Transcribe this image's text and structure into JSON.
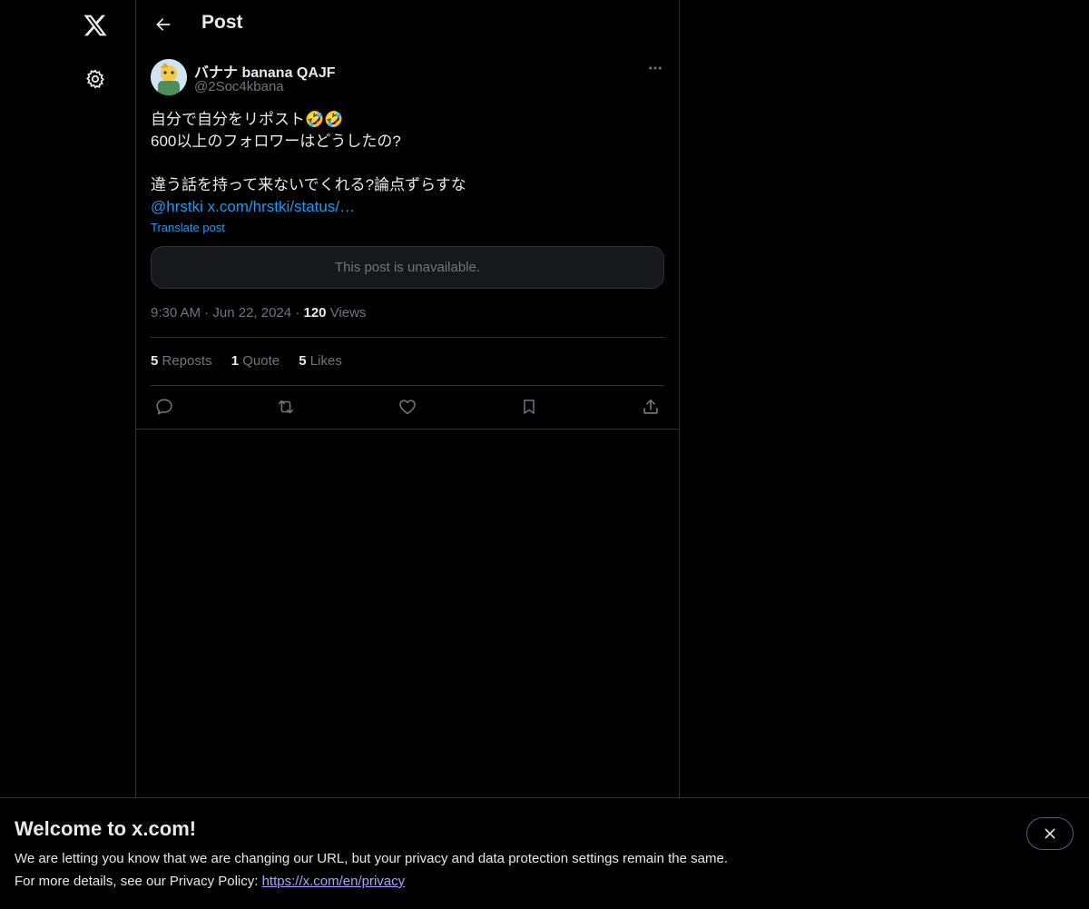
{
  "header": {
    "title": "Post",
    "back_icon": "arrow-left-icon"
  },
  "nav": {
    "logo_icon": "x-logo-icon",
    "settings_icon": "gear-icon"
  },
  "tweet": {
    "author_name": "バナナ banana QAJF",
    "author_handle": "@2Soc4kbana",
    "text_lines": [
      "自分で自分をリポスト🤣🤣",
      "600以上のフォロワーはどうしたの?",
      "",
      "違う話を持って来ないでくれる?論点ずらすな"
    ],
    "link_text": "@hrstki x.com/hrstki/status/…",
    "translate_label": "Translate post",
    "quoted_unavailable": "This post is unavailable.",
    "time": "9:30 AM",
    "date": "Jun 22, 2024",
    "views_count": "120",
    "views_label": "Views",
    "reposts_count": "5",
    "reposts_label": "Reposts",
    "quotes_count": "1",
    "quotes_label": "Quote",
    "likes_count": "5",
    "likes_label": "Likes"
  },
  "banner": {
    "title": "Welcome to x.com!",
    "line1": "We are letting you know that we are changing our URL, but your privacy and data protection settings remain the same.",
    "line2_prefix": "For more details, see our Privacy Policy: ",
    "privacy_link": "https://x.com/en/privacy"
  },
  "colors": {
    "accent": "#1d9bf0",
    "muted": "#71767b",
    "border": "#2f3336",
    "background": "#000000"
  }
}
